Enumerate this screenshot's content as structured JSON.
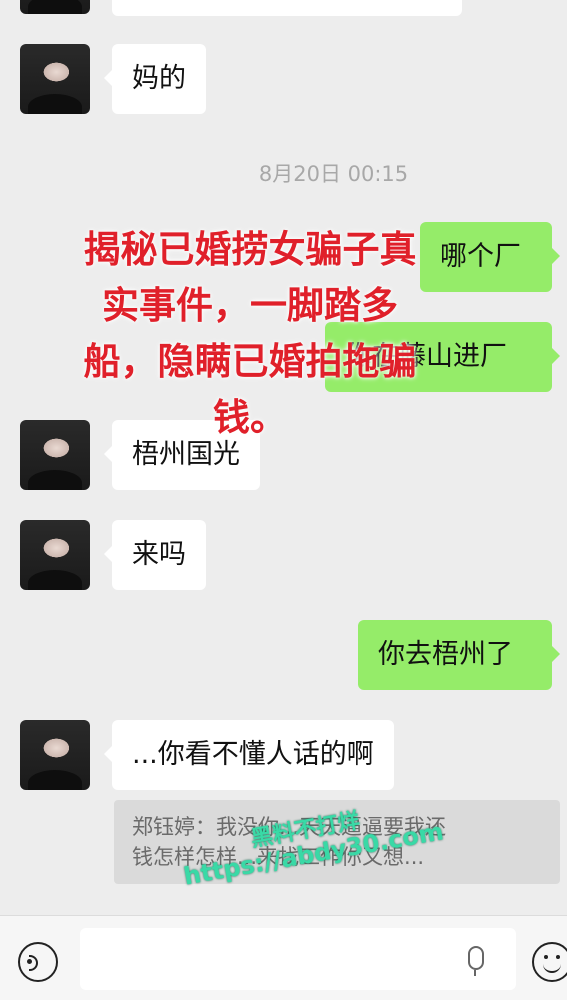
{
  "messages": [
    {
      "text": "妈的"
    },
    {
      "text": "哪个厂"
    },
    {
      "text": "你在藤山进厂"
    },
    {
      "text": "梧州国光"
    },
    {
      "text": "来吗"
    },
    {
      "text": "你去梧州了"
    },
    {
      "text": "...你看不懂人话的啊"
    }
  ],
  "timestamp": "8月20日 00:15",
  "overlay_title": "揭秘已婚捞女骗子真\n实事件，一脚踏多\n船，隐瞒已婚拍拖骗\n钱。",
  "quoted_message": "郑钰婷：我没你...天天逼逼要我还\n钱怎样怎样...来找工作你又想...",
  "watermark": {
    "line1": "黑料不打烊",
    "line2": "https://abdy30.com",
    "color": "#39d9a6"
  },
  "colors": {
    "background": "#ededed",
    "sent_bubble": "#95ec69",
    "received_bubble": "#ffffff",
    "overlay_text": "#e0202a"
  },
  "icons": [
    "voice-icon",
    "microphone-icon",
    "emoji-icon"
  ]
}
